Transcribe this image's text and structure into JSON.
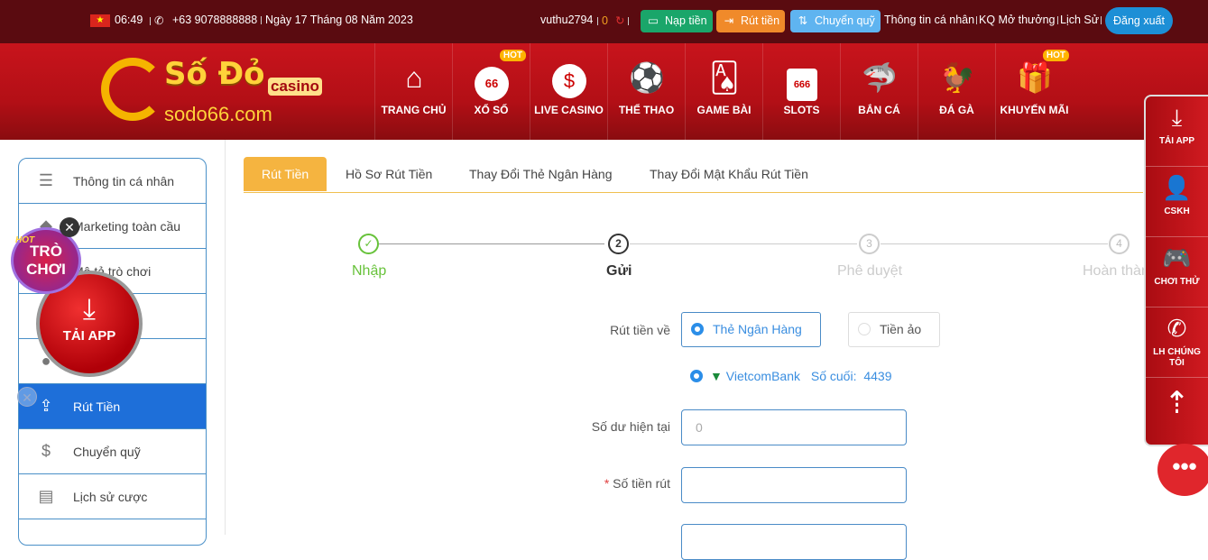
{
  "topbar": {
    "time": "06:49",
    "phone": "+63 9078888888",
    "date": "Ngày 17 Tháng 08 Năm 2023",
    "username": "vuthu2794",
    "balance": "0",
    "deposit": "Nạp tiền",
    "withdraw": "Rút tiền",
    "transfer": "Chuyển quỹ",
    "links": [
      "Thông tin cá nhân",
      "KQ Mở thưởng",
      "Lịch Sử"
    ],
    "logout": "Đăng xuất",
    "colors": {
      "deposit": "#1aa66a",
      "withdraw": "#f08a2a",
      "transfer": "#5fb4f0"
    }
  },
  "logo": {
    "title": "Số Đỏ",
    "badge": "casino",
    "domain": "sodo66.com"
  },
  "nav": [
    {
      "label": "TRANG CHỦ",
      "icon": "home-icon"
    },
    {
      "label": "XỔ SỐ",
      "icon": "lottery-ball-icon",
      "badge": "HOT",
      "ball": "66"
    },
    {
      "label": "LIVE CASINO",
      "icon": "dollar-chip-icon"
    },
    {
      "label": "THỂ THAO",
      "icon": "trophy-icon"
    },
    {
      "label": "GAME BÀI",
      "icon": "cards-icon"
    },
    {
      "label": "SLOTS",
      "icon": "slot-machine-icon",
      "reels": "666"
    },
    {
      "label": "BẮN CÁ",
      "icon": "shark-icon"
    },
    {
      "label": "ĐÁ GÀ",
      "icon": "rooster-icon"
    },
    {
      "label": "KHUYẾN MÃI",
      "icon": "gift-icon",
      "badge": "HOT"
    }
  ],
  "sidebar": [
    {
      "label": "Thông tin cá nhân",
      "icon": "user-card-icon"
    },
    {
      "label": "Marketing toàn cầu",
      "icon": "marketing-icon"
    },
    {
      "label": "Mô tả trò chơi",
      "icon": "game-icon"
    },
    {
      "label": "",
      "icon": "wallet-icon"
    },
    {
      "label": "",
      "icon": "piggy-bank-icon"
    },
    {
      "label": "Rút Tiền",
      "icon": "withdraw-icon",
      "active": true
    },
    {
      "label": "Chuyển quỹ",
      "icon": "transfer-icon"
    },
    {
      "label": "Lịch sử cược",
      "icon": "bet-history-icon"
    }
  ],
  "tabs": [
    "Rút Tiền",
    "Hồ Sơ Rút Tiền",
    "Thay Đổi Thẻ Ngân Hàng",
    "Thay Đổi Mật Khẩu Rút Tiền"
  ],
  "steps": [
    {
      "num": "1",
      "label": "Nhập",
      "state": "done"
    },
    {
      "num": "2",
      "label": "Gửi",
      "state": "current"
    },
    {
      "num": "3",
      "label": "Phê duyệt",
      "state": "pending"
    },
    {
      "num": "4",
      "label": "Hoàn thành",
      "state": "pending"
    }
  ],
  "form": {
    "method_label": "Rút tiền về",
    "method_options": [
      "Thẻ Ngân Hàng",
      "Tiền ảo"
    ],
    "bank_name": "VietcomBank",
    "last_digits_label": "Số cuối:",
    "last_digits": "4439",
    "balance_label": "Số dư hiện tại",
    "balance_value": "0",
    "amount_label": "Số tiền rút",
    "required_mark": "*"
  },
  "float_right": [
    "TẢI APP",
    "CSKH",
    "CHƠI THỬ",
    "LH CHÚNG TÔI"
  ],
  "promo": {
    "tai_app": "TẢI APP",
    "tro_choi": "TRÒ CHƠI",
    "hot": "HOT"
  }
}
